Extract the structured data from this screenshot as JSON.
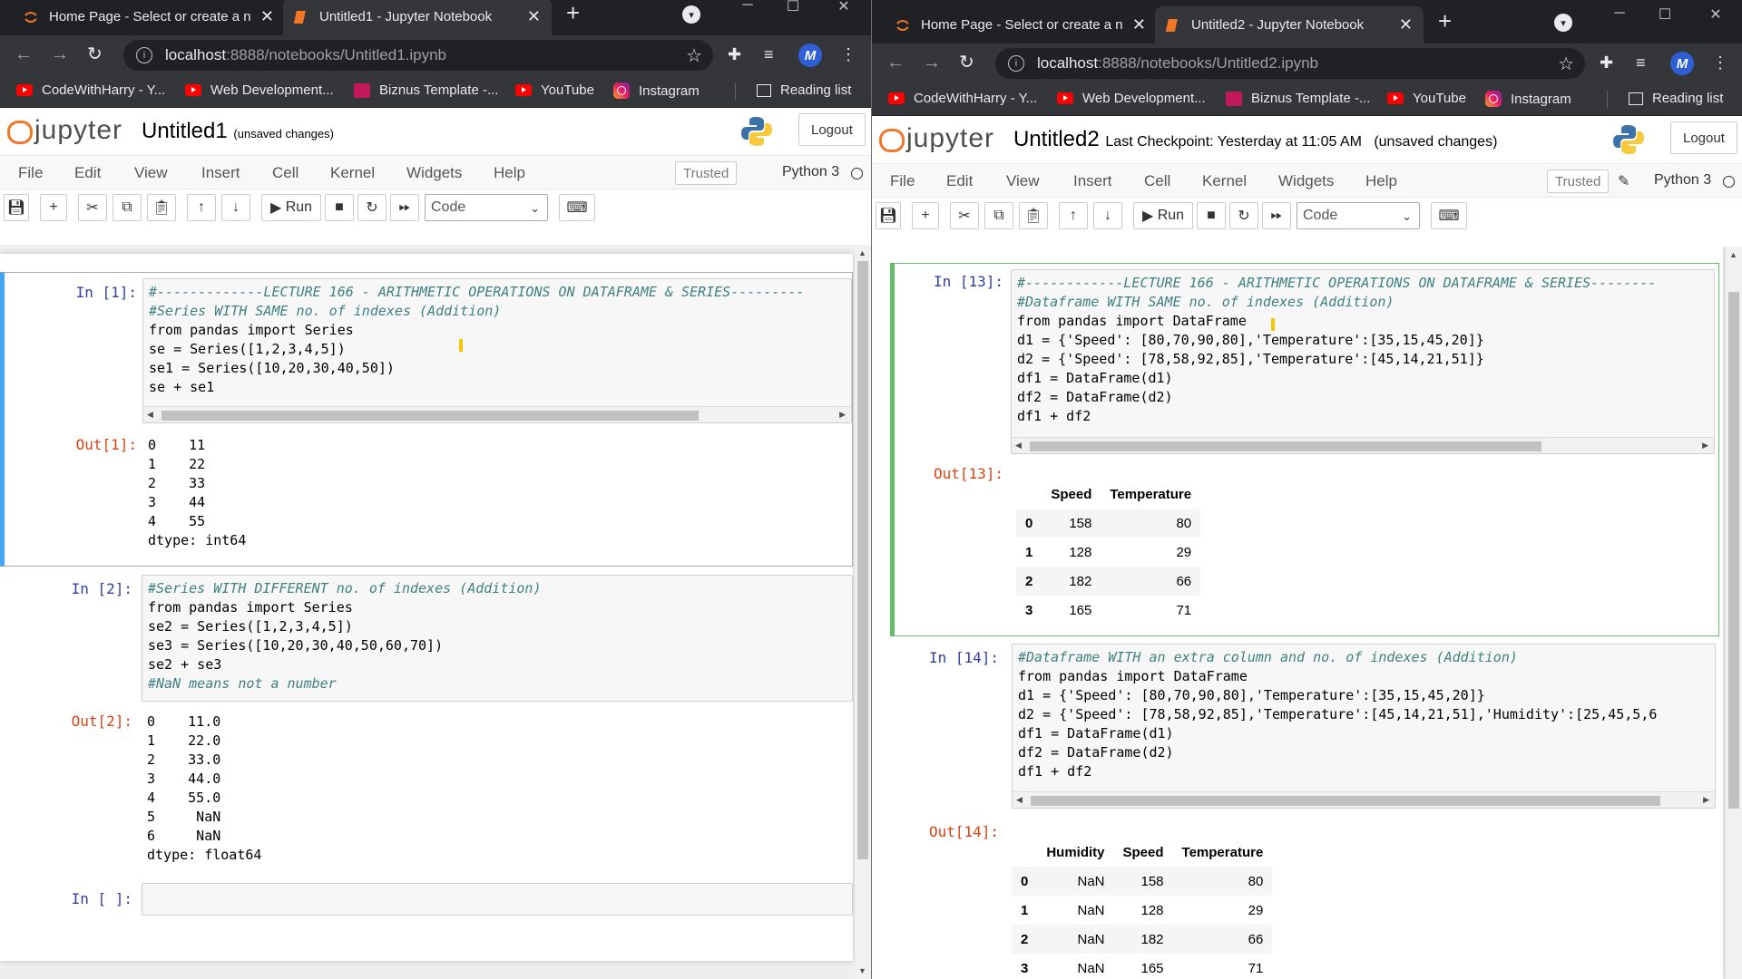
{
  "left": {
    "tabs": [
      {
        "title": "Home Page - Select or create a n",
        "close": "✕"
      },
      {
        "title": "Untitled1 - Jupyter Notebook",
        "close": "✕"
      }
    ],
    "url_host": "localhost",
    "url_path": ":8888/notebooks/Untitled1.ipynb",
    "avatar": "M",
    "bookmarks": [
      "CodeWithHarry - Y...",
      "Web Development...",
      "Biznus Template -...",
      "YouTube",
      "Instagram"
    ],
    "reading_list": "Reading list",
    "jupyter": {
      "logo_text": "jupyter",
      "notebook_name": "Untitled1",
      "checkpoint": "",
      "unsaved": "(unsaved changes)",
      "logout": "Logout",
      "menu": [
        "File",
        "Edit",
        "View",
        "Insert",
        "Cell",
        "Kernel",
        "Widgets",
        "Help"
      ],
      "trusted": "Trusted",
      "kernel": "Python 3",
      "run_label": "Run",
      "cell_type": "Code"
    },
    "cells": [
      {
        "in_prompt": "In [1]:",
        "out_prompt": "Out[1]:",
        "code": [
          "#-------------LECTURE 166 - ARITHMETIC OPERATIONS ON DATAFRAME & SERIES---------",
          "#Series WITH SAME no. of indexes (Addition)",
          "from pandas import Series",
          "se = Series([1,2,3,4,5])",
          "se1 = Series([10,20,30,40,50])",
          "se + se1"
        ],
        "output": [
          "0    11",
          "1    22",
          "2    33",
          "3    44",
          "4    55",
          "dtype: int64"
        ]
      },
      {
        "in_prompt": "In [2]:",
        "out_prompt": "Out[2]:",
        "code": [
          "#Series WITH DIFFERENT no. of indexes (Addition)",
          "from pandas import Series",
          "se2 = Series([1,2,3,4,5])",
          "se3 = Series([10,20,30,40,50,60,70])",
          "se2 + se3",
          "#NaN means not a number"
        ],
        "output": [
          "0    11.0",
          "1    22.0",
          "2    33.0",
          "3    44.0",
          "4    55.0",
          "5     NaN",
          "6     NaN",
          "dtype: float64"
        ]
      },
      {
        "in_prompt": "In [ ]:"
      }
    ]
  },
  "right": {
    "tabs": [
      {
        "title": "Home Page - Select or create a n",
        "close": "✕"
      },
      {
        "title": "Untitled2 - Jupyter Notebook",
        "close": "✕"
      }
    ],
    "url_host": "localhost",
    "url_path": ":8888/notebooks/Untitled2.ipynb",
    "avatar": "M",
    "bookmarks": [
      "CodeWithHarry - Y...",
      "Web Development...",
      "Biznus Template -...",
      "YouTube",
      "Instagram"
    ],
    "reading_list": "Reading list",
    "jupyter": {
      "logo_text": "jupyter",
      "notebook_name": "Untitled2",
      "checkpoint": "Last Checkpoint: Yesterday at 11:05 AM",
      "unsaved": "(unsaved changes)",
      "logout": "Logout",
      "menu": [
        "File",
        "Edit",
        "View",
        "Insert",
        "Cell",
        "Kernel",
        "Widgets",
        "Help"
      ],
      "trusted": "Trusted",
      "kernel": "Python 3",
      "run_label": "Run",
      "cell_type": "Code"
    },
    "cells": [
      {
        "in_prompt": "In [13]:",
        "out_prompt": "Out[13]:",
        "code": [
          "#------------LECTURE 166 - ARITHMETIC OPERATIONS ON DATAFRAME & SERIES--------",
          "#Dataframe WITH SAME no. of indexes (Addition)",
          "from pandas import DataFrame",
          "d1 = {'Speed': [80,70,90,80],'Temperature':[35,15,45,20]}",
          "d2 = {'Speed': [78,58,92,85],'Temperature':[45,14,21,51]}",
          "df1 = DataFrame(d1)",
          "df2 = DataFrame(d2)",
          "df1 + df2"
        ],
        "table": {
          "columns": [
            "",
            "Speed",
            "Temperature"
          ],
          "rows": [
            [
              "0",
              "158",
              "80"
            ],
            [
              "1",
              "128",
              "29"
            ],
            [
              "2",
              "182",
              "66"
            ],
            [
              "3",
              "165",
              "71"
            ]
          ]
        }
      },
      {
        "in_prompt": "In [14]:",
        "out_prompt": "Out[14]:",
        "code": [
          "#Dataframe WITH an extra column and no. of indexes (Addition)",
          "from pandas import DataFrame",
          "d1 = {'Speed': [80,70,90,80],'Temperature':[35,15,45,20]}",
          "d2 = {'Speed': [78,58,92,85],'Temperature':[45,14,21,51],'Humidity':[25,45,5,6",
          "df1 = DataFrame(d1)",
          "df2 = DataFrame(d2)",
          "df1 + df2"
        ],
        "table": {
          "columns": [
            "",
            "Humidity",
            "Speed",
            "Temperature"
          ],
          "rows": [
            [
              "0",
              "NaN",
              "158",
              "80"
            ],
            [
              "1",
              "NaN",
              "128",
              "29"
            ],
            [
              "2",
              "NaN",
              "182",
              "66"
            ],
            [
              "3",
              "NaN",
              "165",
              "71"
            ]
          ]
        }
      }
    ]
  }
}
